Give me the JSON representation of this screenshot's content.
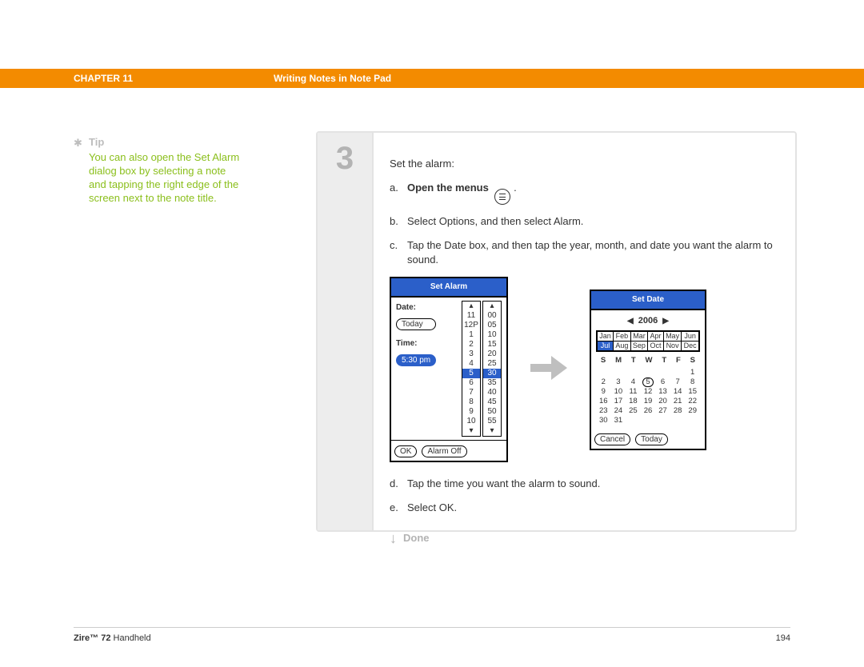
{
  "header": {
    "chapter": "CHAPTER 11",
    "title": "Writing Notes in Note Pad"
  },
  "tip": {
    "label": "Tip",
    "text": "You can also open the Set Alarm dialog box by selecting a note and tapping the right edge of the screen next to the note title."
  },
  "step": {
    "number": "3",
    "intro": "Set the alarm:",
    "a": {
      "marker": "a.",
      "bold": "Open the menus",
      "after": " ."
    },
    "b": {
      "marker": "b.",
      "text": "Select Options, and then select Alarm."
    },
    "c": {
      "marker": "c.",
      "text": "Tap the Date box, and then tap the year, month, and date you want the alarm to sound."
    },
    "d": {
      "marker": "d.",
      "text": "Tap the time you want the alarm to sound."
    },
    "e": {
      "marker": "e.",
      "text": "Select OK."
    },
    "done": "Done"
  },
  "setAlarm": {
    "title": "Set Alarm",
    "dateLabel": "Date:",
    "today": "Today",
    "timeLabel": "Time:",
    "time": "5:30 pm",
    "hours": [
      "11",
      "12P",
      "1",
      "2",
      "3",
      "4",
      "5",
      "6",
      "7",
      "8",
      "9",
      "10"
    ],
    "hourSel": "5",
    "minutes": [
      "00",
      "05",
      "10",
      "15",
      "20",
      "25",
      "30",
      "35",
      "40",
      "45",
      "50",
      "55"
    ],
    "minuteSel": "30",
    "ok": "OK",
    "alarmOff": "Alarm Off"
  },
  "setDate": {
    "title": "Set Date",
    "year": "2006",
    "months": [
      [
        "Jan",
        "Feb",
        "Mar",
        "Apr",
        "May",
        "Jun"
      ],
      [
        "Jul",
        "Aug",
        "Sep",
        "Oct",
        "Nov",
        "Dec"
      ]
    ],
    "monthSel": "Jul",
    "dow": [
      "S",
      "M",
      "T",
      "W",
      "T",
      "F",
      "S"
    ],
    "days": [
      "",
      "",
      "",
      "",
      "",
      "",
      "1",
      "2",
      "3",
      "4",
      "5",
      "6",
      "7",
      "8",
      "9",
      "10",
      "11",
      "12",
      "13",
      "14",
      "15",
      "16",
      "17",
      "18",
      "19",
      "20",
      "21",
      "22",
      "23",
      "24",
      "25",
      "26",
      "27",
      "28",
      "29",
      "30",
      "31",
      "",
      "",
      "",
      "",
      ""
    ],
    "daySel": "5",
    "cancel": "Cancel",
    "today": "Today"
  },
  "footer": {
    "product_bold": "Zire™ 72",
    "product_rest": " Handheld",
    "page": "194"
  }
}
